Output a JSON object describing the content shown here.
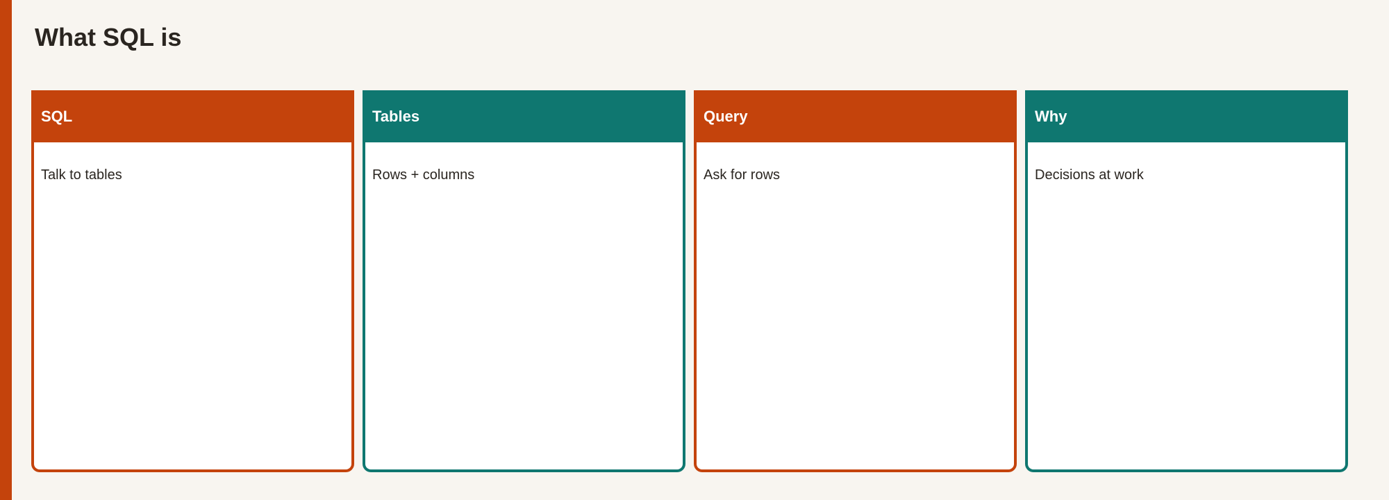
{
  "page": {
    "title": "What SQL is"
  },
  "colors": {
    "accent_orange": "#c4430c",
    "accent_teal": "#0f7770",
    "background": "#f8f5f0"
  },
  "cards": [
    {
      "heading": "SQL",
      "body": "Talk to tables",
      "color": "#c4430c"
    },
    {
      "heading": "Tables",
      "body": "Rows + columns",
      "color": "#0f7770"
    },
    {
      "heading": "Query",
      "body": "Ask for rows",
      "color": "#c4430c"
    },
    {
      "heading": "Why",
      "body": "Decisions at work",
      "color": "#0f7770"
    }
  ]
}
